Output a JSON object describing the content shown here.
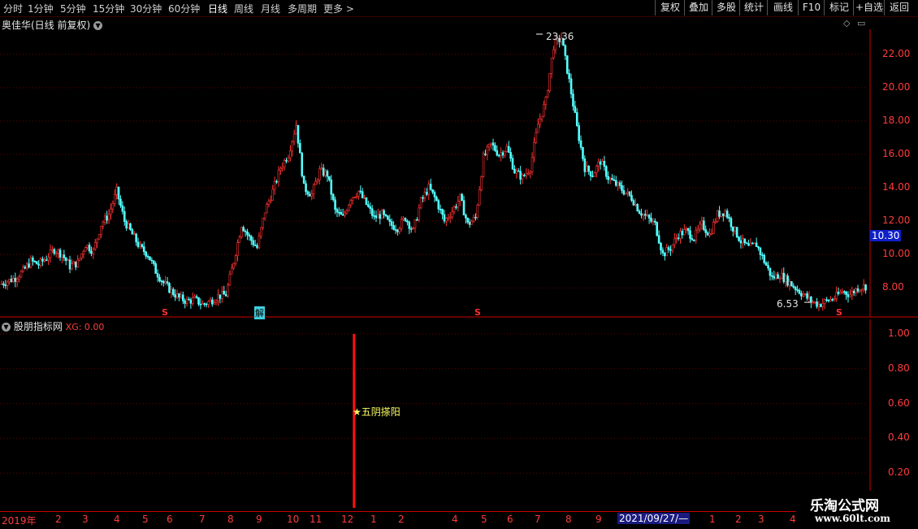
{
  "toolbar": {
    "periods": [
      "分时",
      "1分钟",
      "5分钟",
      "15分钟",
      "30分钟",
      "60分钟",
      "日线",
      "周线",
      "月线",
      "多周期",
      "更多"
    ],
    "active_period": "日线",
    "buttons": [
      "复权",
      "叠加",
      "多股",
      "统计",
      "画线",
      "F10",
      "标记",
      "+自选",
      "返回"
    ]
  },
  "main_chart": {
    "title": "奥佳华(日线 前复权)",
    "y_ticks": [
      "22.00",
      "20.00",
      "18.00",
      "16.00",
      "14.00",
      "12.00",
      "10.00",
      "8.00"
    ],
    "current_price": "10.30",
    "high_label": "23.36",
    "low_label": "6.53",
    "signal_s": "S",
    "signal_jie": "解"
  },
  "indicator": {
    "name": "股朋指标网",
    "xg_label": "XG: 0.00",
    "y_ticks": [
      "1.00",
      "0.80",
      "0.60",
      "0.40",
      "0.20"
    ],
    "annotation": "★五阴搽阳"
  },
  "date_axis": {
    "labels": [
      "2019年",
      "2",
      "3",
      "4",
      "5",
      "6",
      "7",
      "8",
      "9",
      "10",
      "11",
      "12",
      "1",
      "2",
      "4",
      "5",
      "6",
      "7",
      "8",
      "9",
      "2",
      "1",
      "2",
      "3",
      "4"
    ],
    "cursor_date": "2021/09/27/—"
  },
  "watermark": {
    "name": "乐淘公式网",
    "url": "www.60lt.com"
  },
  "chart_data": {
    "type": "candlestick",
    "y_range": [
      6.5,
      23.5
    ],
    "closes": [
      8.2,
      8.4,
      8.6,
      9.0,
      9.6,
      9.4,
      9.8,
      10.3,
      10.0,
      9.3,
      9.5,
      10.6,
      10.2,
      11.8,
      12.4,
      13.8,
      12.0,
      11.2,
      10.4,
      10.0,
      9.0,
      8.3,
      7.8,
      7.4,
      7.2,
      7.3,
      7.0,
      7.2,
      7.5,
      7.6,
      9.6,
      11.8,
      11.0,
      10.4,
      12.6,
      13.8,
      15.2,
      16.0,
      17.8,
      14.0,
      13.6,
      15.0,
      14.8,
      12.6,
      12.2,
      13.4,
      13.8,
      13.0,
      12.2,
      12.4,
      11.8,
      11.6,
      12.2,
      11.4,
      13.2,
      14.0,
      13.2,
      12.0,
      12.6,
      13.4,
      11.8,
      12.2,
      15.8,
      16.6,
      16.0,
      16.4,
      15.0,
      14.6,
      15.2,
      17.8,
      19.2,
      22.5,
      23.0,
      20.4,
      17.6,
      15.2,
      14.8,
      15.6,
      14.6,
      14.2,
      13.8,
      13.4,
      12.6,
      12.2,
      11.8,
      10.0,
      10.4,
      11.2,
      11.4,
      11.0,
      11.8,
      11.2,
      12.4,
      12.6,
      11.6,
      10.8,
      10.4,
      10.6,
      9.6,
      8.6,
      8.8,
      8.4,
      8.0,
      7.6,
      7.2,
      7.0,
      7.2,
      7.4,
      7.8,
      7.6,
      8.0,
      8.1
    ],
    "xg_signal": {
      "value": 1.0,
      "position_index": 0.383
    }
  }
}
